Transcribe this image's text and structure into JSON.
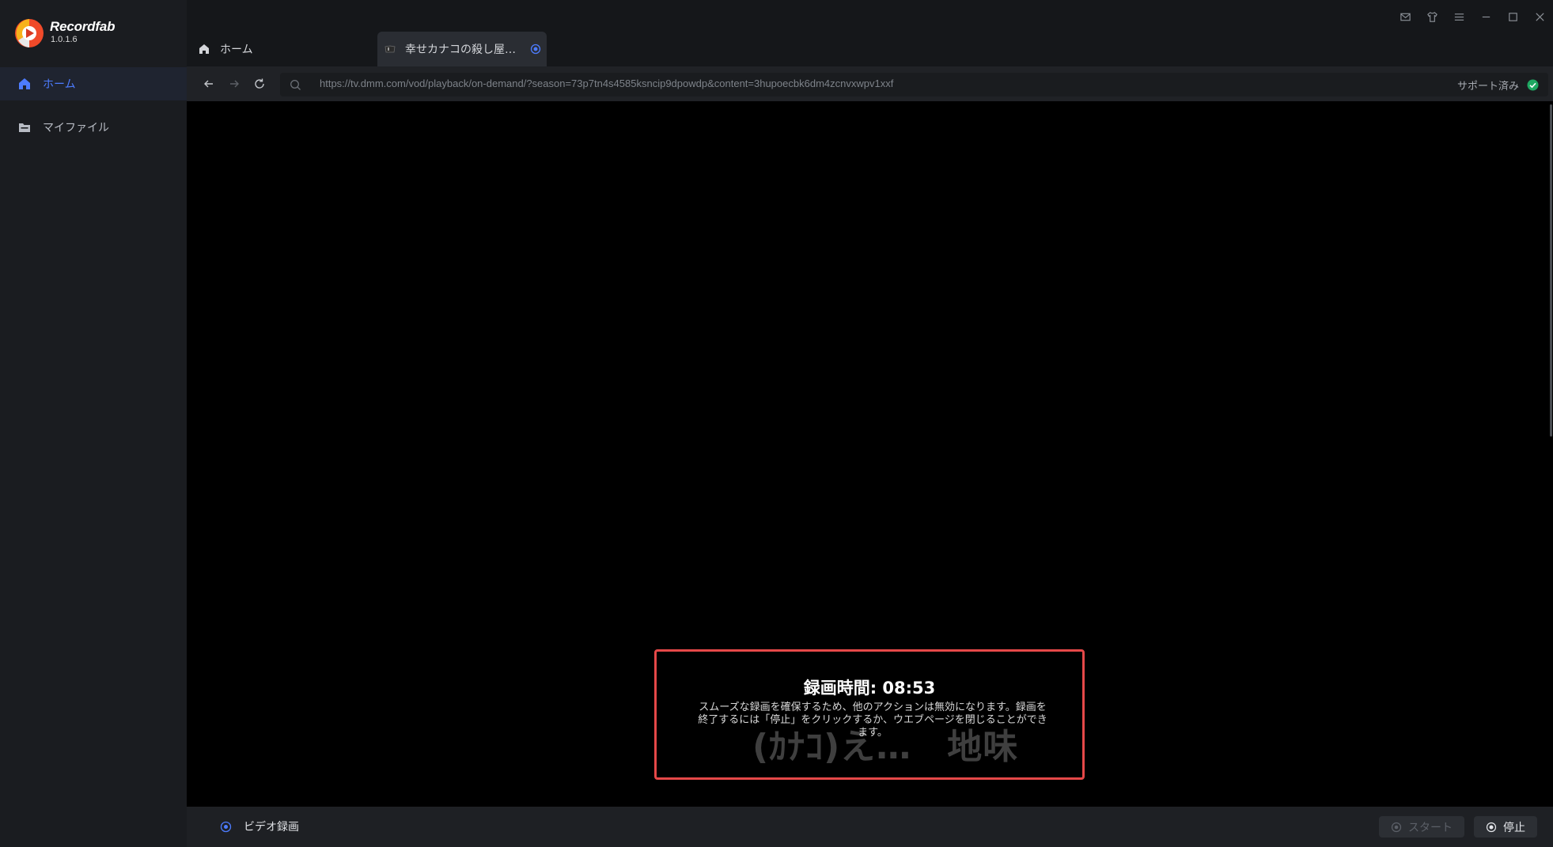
{
  "app": {
    "name": "Recordfab",
    "version": "1.0.1.6"
  },
  "sidebar": {
    "items": [
      {
        "label": "ホーム",
        "icon": "home-icon",
        "active": true
      },
      {
        "label": "マイファイル",
        "icon": "folder-icon",
        "active": false
      }
    ]
  },
  "window_controls": [
    "mail-icon",
    "shirt-icon",
    "menu-icon",
    "minimize-icon",
    "maximize-icon",
    "close-icon"
  ],
  "tabs": [
    {
      "label": "ホーム",
      "icon": "home-icon"
    },
    {
      "label": "幸せカナコの殺し屋…",
      "icon": "site-favicon-icon",
      "recording": true
    }
  ],
  "toolbar": {
    "url": "https://tv.dmm.com/vod/playback/on-demand/?season=73p7tn4s4585ksncip9dpowdp&content=3hupoecbk6dm4zcnvxwpv1xxf",
    "support_label": "サポート済み"
  },
  "video": {
    "subtitle": "(ｶﾅｺ)え…　地味"
  },
  "recording": {
    "time_label": "録画時間: 08:53",
    "message": "スムーズな録画を確保するため、他のアクションは無効になります。録画を終了するには「停止」をクリックするか、ウエブページを閉じることができます。"
  },
  "bottom": {
    "mode_label": "ビデオ録画",
    "start_label": "スタート",
    "stop_label": "停止"
  },
  "colors": {
    "accent": "#4d7cff",
    "highlight_border": "#e54848",
    "support_ok": "#1fa862",
    "background": "#15171a"
  }
}
